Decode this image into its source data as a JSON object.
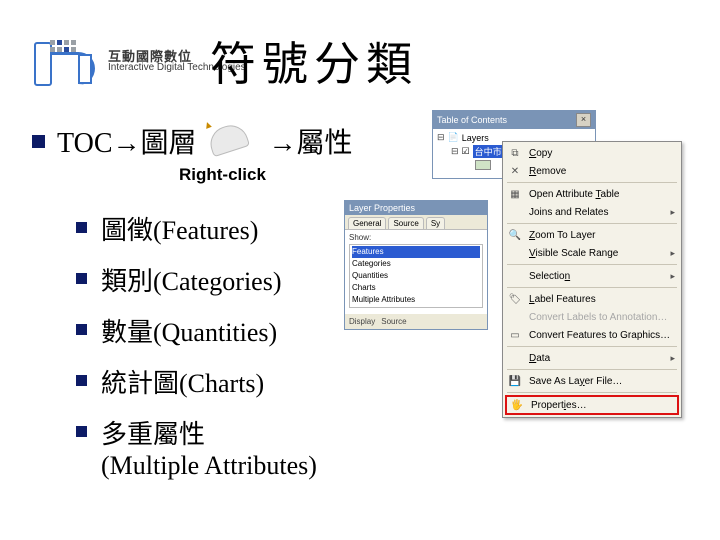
{
  "logo": {
    "cn": "互動國際數位",
    "en": "Interactive Digital Technologies"
  },
  "title": "符號分類",
  "main_bullet": {
    "a": "TOC→圖層",
    "b": "→屬性"
  },
  "right_click_label": "Right-click",
  "subs": [
    "圖徵(Features)",
    "類別(Categories)",
    "數量(Quantities)",
    "統計圖(Charts)",
    "多重屬性\n(Multiple Attributes)"
  ],
  "toc": {
    "title": "Table of Contents",
    "root": "Layers",
    "item": "台中市行政區"
  },
  "lp": {
    "title": "Layer Properties",
    "tabs": [
      "General",
      "Source",
      "Sy"
    ],
    "show_label": "Show:",
    "options": [
      "Features",
      "Categories",
      "Quantities",
      "Charts",
      "Multiple Attributes"
    ],
    "foot": [
      "Display",
      "Source"
    ]
  },
  "menu": {
    "items": [
      {
        "icon": "copy",
        "label_html": "<span class='u'>C</span>opy"
      },
      {
        "icon": "x",
        "label_html": "<span class='u'>R</span>emove"
      },
      {
        "sep": true
      },
      {
        "icon": "table",
        "label_html": "Open Attribute <span class='u'>T</span>able"
      },
      {
        "icon": "",
        "label_html": "Joins and Relates",
        "sub": true
      },
      {
        "sep": true
      },
      {
        "icon": "zoom",
        "label_html": "<span class='u'>Z</span>oom To Layer"
      },
      {
        "icon": "",
        "label_html": "<span class='u'>V</span>isible Scale Range",
        "sub": true
      },
      {
        "sep": true
      },
      {
        "icon": "",
        "label_html": "Selectio<span class='u'>n</span>",
        "sub": true
      },
      {
        "sep": true
      },
      {
        "icon": "tag",
        "label_html": "<span class='u'>L</span>abel Features"
      },
      {
        "icon": "",
        "label_html": "Convert Labels to Annotation…",
        "dis": true
      },
      {
        "icon": "sel",
        "label_html": "Convert Features to Graphics…"
      },
      {
        "sep": true
      },
      {
        "icon": "",
        "label_html": "<span class='u'>D</span>ata",
        "sub": true
      },
      {
        "sep": true
      },
      {
        "icon": "disk",
        "label_html": "Save As La<span class='u'>y</span>er File…"
      },
      {
        "sep": true
      },
      {
        "icon": "prop",
        "label_html": "Propert<span class='u'>i</span>es…",
        "hi": true
      }
    ]
  }
}
